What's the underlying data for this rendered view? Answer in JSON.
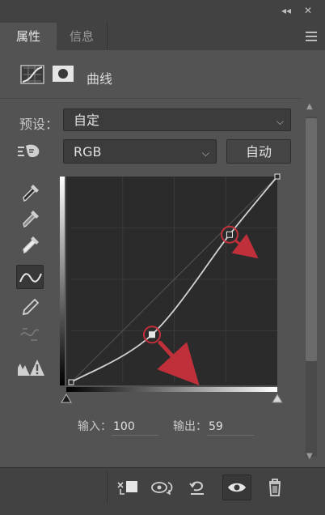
{
  "tabs": {
    "properties": "属性",
    "info": "信息"
  },
  "panel": {
    "title": "曲线"
  },
  "preset": {
    "label": "预设：",
    "value": "自定"
  },
  "channel": {
    "value": "RGB"
  },
  "auto_button": {
    "label": "自动"
  },
  "io": {
    "input_label": "输入：",
    "input_value": "100",
    "output_label": "输出：",
    "output_value": "59"
  },
  "curve": {
    "range": [
      0,
      255
    ],
    "points": [
      {
        "input": 0,
        "output": 0
      },
      {
        "input": 100,
        "output": 59
      },
      {
        "input": 196,
        "output": 183
      },
      {
        "input": 255,
        "output": 255
      }
    ],
    "grid_divisions": 4,
    "highlighted_points": [
      1,
      2
    ]
  },
  "colors": {
    "panel_bg": "#535353",
    "annotation": "#c0303a",
    "curve": "#d2d2d2",
    "grid": "#3a3a3a"
  },
  "icons": {
    "tools": [
      "eyedropper-black-icon",
      "eyedropper-gray-icon",
      "eyedropper-white-icon",
      "curve-edit-icon",
      "pencil-draw-icon",
      "smooth-curve-icon",
      "clipping-warning-icon"
    ],
    "footer": [
      "clip-to-layer-icon",
      "view-previous-state-icon",
      "reset-icon",
      "visibility-eye-icon",
      "delete-icon"
    ]
  }
}
